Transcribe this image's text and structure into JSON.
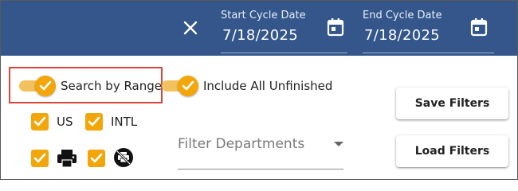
{
  "header": {
    "close_icon": "close-icon",
    "start_date": {
      "label": "Start Cycle Date",
      "value": "7/18/2025",
      "icon": "calendar-icon"
    },
    "end_date": {
      "label": "End Cycle Date",
      "value": "7/18/2025",
      "icon": "calendar-icon"
    },
    "background_color": "#34568b"
  },
  "toggles": {
    "search_by_range": {
      "label": "Search by Range",
      "checked": true
    },
    "include_all_unfinished": {
      "label": "Include All Unfinished",
      "checked": true
    }
  },
  "checkboxes": {
    "us": {
      "label": "US",
      "checked": true
    },
    "intl": {
      "label": "INTL",
      "checked": true
    },
    "print": {
      "icon": "printer-icon",
      "checked": true
    },
    "no_print": {
      "icon": "print-disabled-icon",
      "checked": true
    }
  },
  "filter_departments": {
    "placeholder": "Filter Departments"
  },
  "buttons": {
    "save": "Save Filters",
    "load": "Load Filters"
  },
  "colors": {
    "accent": "#f2a60a",
    "highlight": "#d9453a"
  }
}
